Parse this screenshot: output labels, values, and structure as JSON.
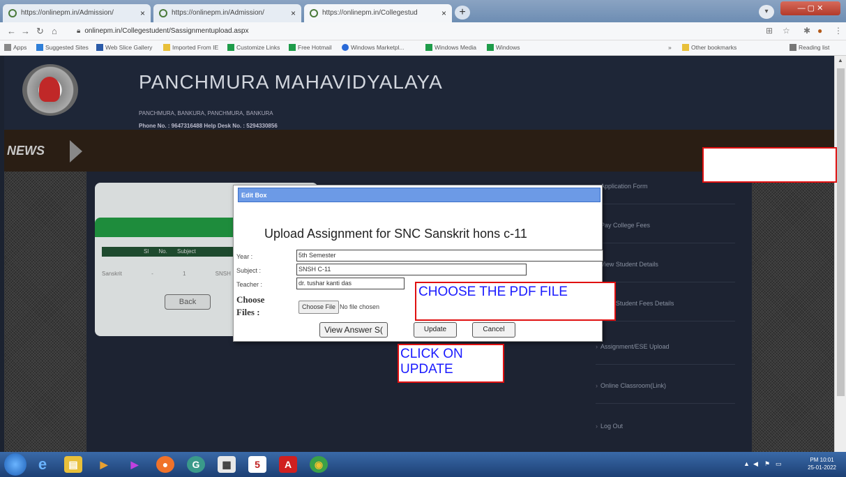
{
  "browser": {
    "tabs": [
      {
        "title": "https://onlinepm.in/Admission/"
      },
      {
        "title": "https://onlinepm.in/Admission/"
      },
      {
        "title": "https://onlinepm.in/Collegestud"
      }
    ],
    "new_tab": "+",
    "url": "onlinepm.in/Collegestudent/Sassignmentupload.aspx",
    "bookmarks": [
      {
        "label": "Apps",
        "color": "#888888"
      },
      {
        "label": "Suggested Sites",
        "color": "#2f7fd8"
      },
      {
        "label": "Web Slice Gallery",
        "color": "#2a5aa8"
      },
      {
        "label": "Imported From IE",
        "color": "#e8c03a"
      },
      {
        "label": "Customize Links",
        "color": "#1e9c4a"
      },
      {
        "label": "Free Hotmail",
        "color": "#1e9c4a"
      },
      {
        "label": "Windows Marketpl...",
        "color": "#2a6ad8"
      },
      {
        "label": "Windows Media",
        "color": "#1e9c4a"
      },
      {
        "label": "Windows",
        "color": "#1e9c4a"
      },
      {
        "label": "Other bookmarks",
        "color": "#e8c03a"
      },
      {
        "label": "Reading list",
        "color": "#777777"
      }
    ]
  },
  "site": {
    "college_name": "PANCHMURA MAHAVIDYALAYA",
    "address": "PANCHMURA, BANKURA, PANCHMURA, BANKURA",
    "phone": "Phone No. : 9647316488   Help Desk No. : 5294330856",
    "news": "NEWS"
  },
  "panel": {
    "table_header": "Sl No. Subject",
    "row": "Sanskrit - 1  SNSH C-11",
    "back": "Back"
  },
  "menu": [
    "Application Form",
    "Pay College Fees",
    "View Student Details",
    "View Student Fees Details",
    "Assignment/ESE Upload",
    "Online Classroom(Link)",
    "Log Out"
  ],
  "dialog": {
    "title": "Edit Box",
    "heading": "Upload Assignment for SNC Sanskrit hons c-11",
    "year_label": "Year :",
    "year_value": "5th Semester",
    "subject_label": "Subject :",
    "subject_value": "SNSH C-11",
    "teacher_label": "Teacher :",
    "teacher_value": "dr. tushar kanti das",
    "choose_label": "Choose Files :",
    "choose_file_btn": "Choose File",
    "no_file": "No file chosen",
    "view_answer": "View Answer S(",
    "update": "Update",
    "cancel": "Cancel"
  },
  "annotations": {
    "choose_pdf": "CHOOSE THE PDF FILE",
    "click_update": "CLICK ON UPDATE"
  },
  "tray": {
    "time": "PM 10:01",
    "date": "25-01-2022"
  }
}
